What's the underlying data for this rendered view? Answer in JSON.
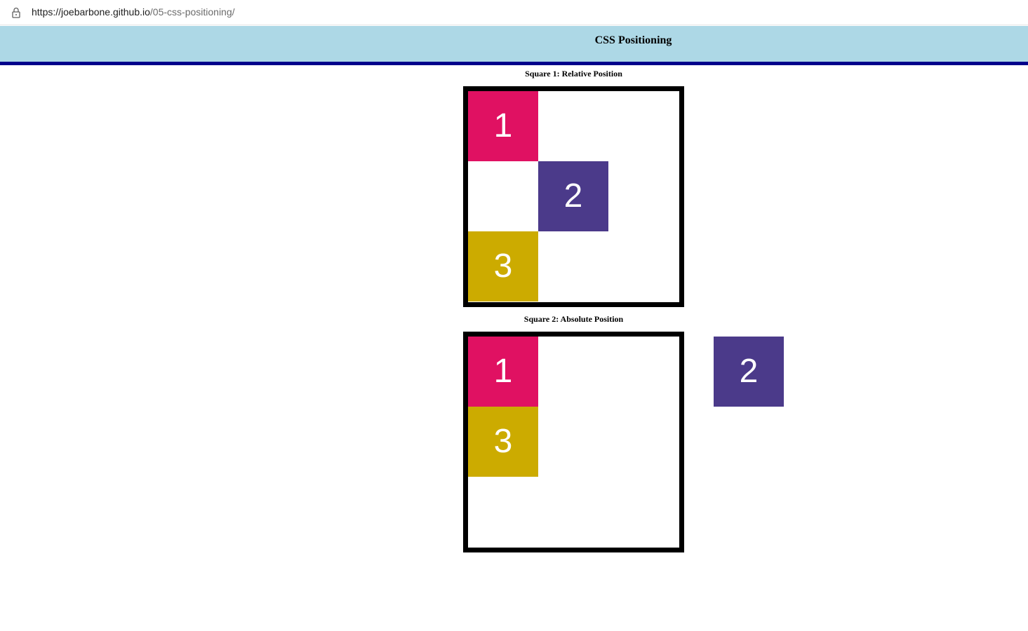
{
  "browser": {
    "url_host": "https://joebarbone.github.io",
    "url_path": "/05-css-positioning/"
  },
  "header": {
    "title": "CSS Positioning"
  },
  "square1": {
    "title": "Square 1: Relative Position",
    "boxes": [
      "1",
      "2",
      "3"
    ]
  },
  "square2": {
    "title": "Square 2: Absolute Position",
    "boxes": [
      "1",
      "2",
      "3"
    ]
  },
  "colors": {
    "header_bg": "#add8e6",
    "header_border": "#00008b",
    "box1": "#e01162",
    "box2": "#4b3a8a",
    "box3": "#ccab00"
  },
  "icons": {
    "lock": "lock-icon"
  }
}
